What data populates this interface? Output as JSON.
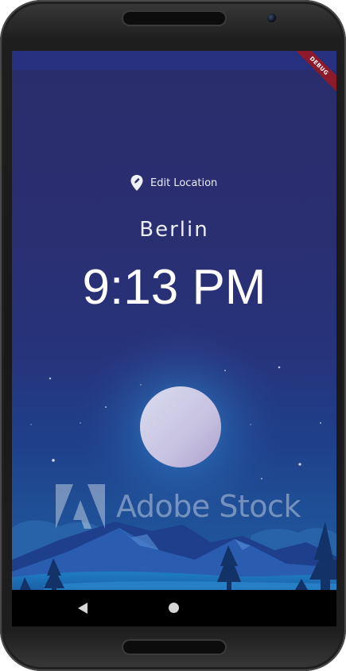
{
  "app": {
    "debug_banner": "DEBUG"
  },
  "location": {
    "edit_label": "Edit Location",
    "icon": "location-pin-icon",
    "city": "Berlin",
    "time": "9:13 PM"
  },
  "background": {
    "scene": "night-moon-mountains",
    "watermark_text": "Adobe Stock"
  },
  "navigation": {
    "back_icon": "back-triangle-icon",
    "home_icon": "home-circle-icon"
  },
  "colors": {
    "sky_top": "#2a2d6b",
    "sky_bottom": "#1e5aa0",
    "debug_banner": "#8c1a2a",
    "text": "#ffffff"
  }
}
